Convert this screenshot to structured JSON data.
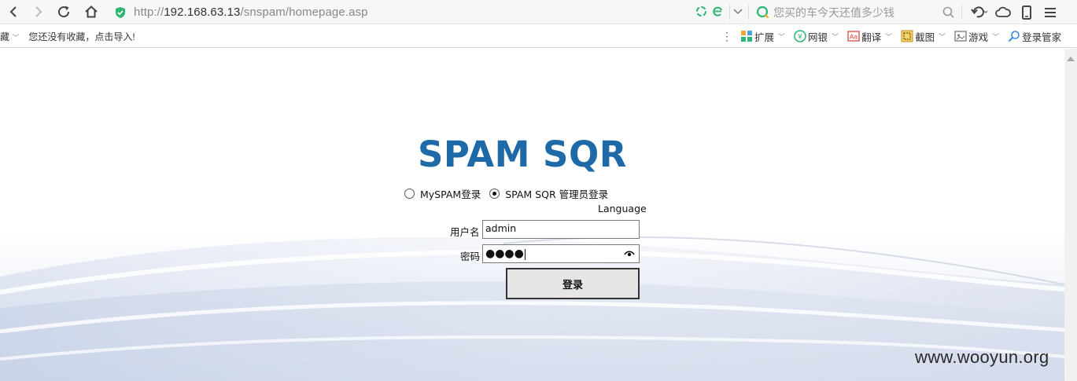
{
  "browser": {
    "url_scheme": "http://",
    "url_host": "192.168.63.13",
    "url_path": "/snspam/homepage.asp",
    "search_placeholder": "您买的车今天还值多少钱",
    "icons": {
      "back": "back-arrow-icon",
      "forward": "forward-arrow-icon",
      "reload": "reload-icon",
      "home": "home-icon",
      "secure": "shield-icon",
      "search": "search-icon",
      "undo": "undo-icon",
      "cloud": "cloud-icon",
      "phone": "phone-icon",
      "menu": "menu-icon"
    }
  },
  "bookmarks": {
    "left_label": "藏",
    "empty_text": "您还没有收藏，点击导入!",
    "items": [
      {
        "label": "扩展",
        "icon": "extension-icon"
      },
      {
        "label": "网银",
        "icon": "bank-icon"
      },
      {
        "label": "翻译",
        "icon": "translate-icon"
      },
      {
        "label": "截图",
        "icon": "screenshot-icon"
      },
      {
        "label": "游戏",
        "icon": "game-icon"
      },
      {
        "label": "登录管家",
        "icon": "login-manager-icon"
      }
    ]
  },
  "login": {
    "logo": "SPAM SQR",
    "radio_options": [
      {
        "label": "MySPAM登录",
        "checked": false
      },
      {
        "label": "SPAM SQR 管理员登录",
        "checked": true
      }
    ],
    "language_link": "Language",
    "username_label": "用户名",
    "username_value": "admin",
    "password_label": "密码",
    "password_masked": "●●●●",
    "submit_label": "登录"
  },
  "watermark": "www.wooyun.org",
  "colors": {
    "logo_blue": "#1e6aa8",
    "secure_green": "#2bb673"
  }
}
